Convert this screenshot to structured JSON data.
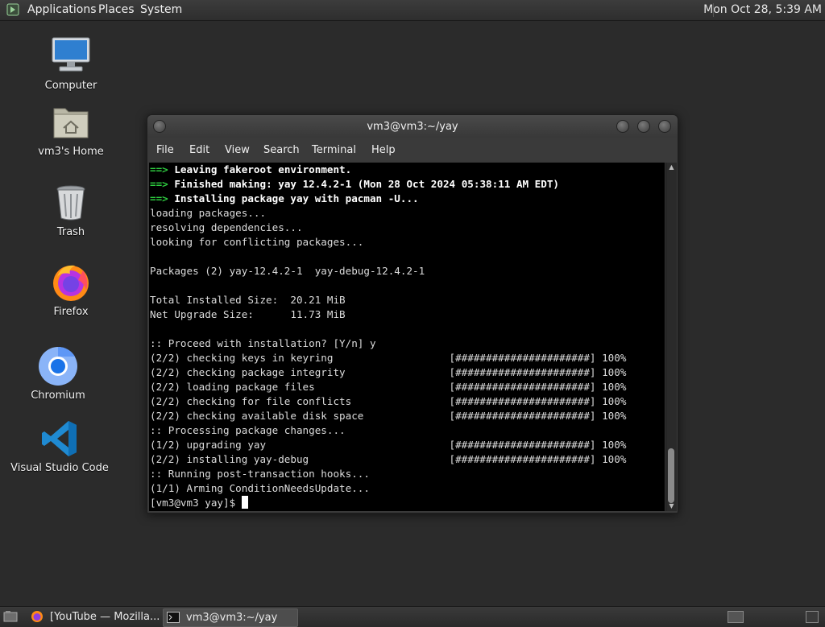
{
  "top_panel": {
    "menus": [
      "Applications",
      "Places",
      "System"
    ],
    "clock": "Mon Oct 28,  5:39 AM"
  },
  "desktop": {
    "icons": [
      {
        "label": "Computer",
        "icon": "computer-icon"
      },
      {
        "label": "vm3's Home",
        "icon": "home-folder-icon"
      },
      {
        "label": "Trash",
        "icon": "trash-icon"
      },
      {
        "label": "Firefox",
        "icon": "firefox-icon"
      },
      {
        "label": "Chromium",
        "icon": "chromium-icon"
      },
      {
        "label": "Visual Studio Code",
        "icon": "vscode-icon"
      }
    ]
  },
  "terminal": {
    "title": "vm3@vm3:~/yay",
    "menu": [
      "File",
      "Edit",
      "View",
      "Search",
      "Terminal",
      "Help"
    ],
    "lines": [
      "Leaving fakeroot environment.",
      "Finished making: yay 12.4.2-1 (Mon 28 Oct 2024 05:38:11 AM EDT)",
      "Installing package yay with pacman -U...",
      "loading packages...",
      "resolving dependencies...",
      "looking for conflicting packages...",
      "",
      "Packages (2) yay-12.4.2-1  yay-debug-12.4.2-1",
      "",
      "Total Installed Size:  20.21 MiB",
      "Net Upgrade Size:      11.73 MiB",
      "",
      ":: Proceed with installation? [Y/n] y",
      "(2/2) checking keys in keyring                   [######################] 100%",
      "(2/2) checking package integrity                 [######################] 100%",
      "(2/2) loading package files                      [######################] 100%",
      "(2/2) checking for file conflicts                [######################] 100%",
      "(2/2) checking available disk space              [######################] 100%",
      ":: Processing package changes...",
      "(1/2) upgrading yay                              [######################] 100%",
      "(2/2) installing yay-debug                       [######################] 100%",
      ":: Running post-transaction hooks...",
      "(1/1) Arming ConditionNeedsUpdate...",
      "[vm3@vm3 yay]$ "
    ],
    "arrow": "==>",
    "arrow_lines": [
      0,
      1,
      2
    ]
  },
  "taskbar": {
    "tasks": [
      {
        "label": "[YouTube — Mozilla...",
        "icon": "firefox-icon",
        "active": false
      },
      {
        "label": "vm3@vm3:~/yay",
        "icon": "terminal-icon",
        "active": true
      }
    ]
  },
  "colors": {
    "prompt_arrow": "#2ecc40",
    "terminal_bg": "#000000"
  }
}
